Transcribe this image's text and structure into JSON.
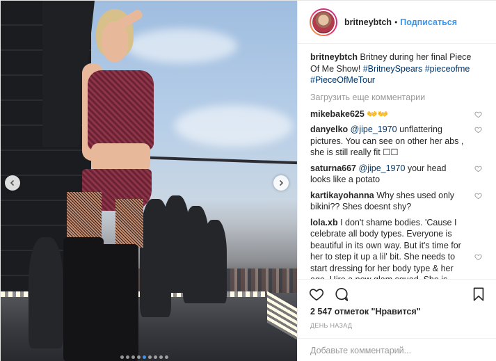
{
  "header": {
    "username": "britneybtch",
    "separator": "•",
    "follow_label": "Подписаться"
  },
  "caption": {
    "username": "britneybtch",
    "text": " Britney during her final Piece Of Me Show! ",
    "tags": [
      "#BritneySpears",
      "#pieceofme",
      "#PieceOfMeTour"
    ]
  },
  "load_more_label": "Загрузить еще комментарии",
  "comments": [
    {
      "username": "mikebake625",
      "text": " 👐👐"
    },
    {
      "username": "danyelko",
      "mention": "@jipe_1970",
      "text": " unflattering pictures. You can see on other her abs , she is still really fit ☐☐"
    },
    {
      "username": "saturna667",
      "mention": "@jipe_1970",
      "text": " your head looks like a potato"
    },
    {
      "username": "kartikayohanna",
      "text": " Why shes used only bikini?? Shes doesnt shy?"
    },
    {
      "username": "lola.xb",
      "text": " I don't shame bodies. 'Cause I celebrate all body types. Everyone is beautiful in its own way. But it's time for her to step it up a lil' bit. She needs to start dressing for her body type & her age. Hire a new glam squad. She is"
    }
  ],
  "likes_text": "2 547 отметок \"Нравится\"",
  "time_text": "ДЕНЬ НАЗАД",
  "add_comment_placeholder": "Добавьте комментарий...",
  "carousel": {
    "count": 9,
    "active": 4
  },
  "colors": {
    "link": "#3897f0",
    "tag": "#003569",
    "muted": "#999999",
    "text": "#262626"
  }
}
